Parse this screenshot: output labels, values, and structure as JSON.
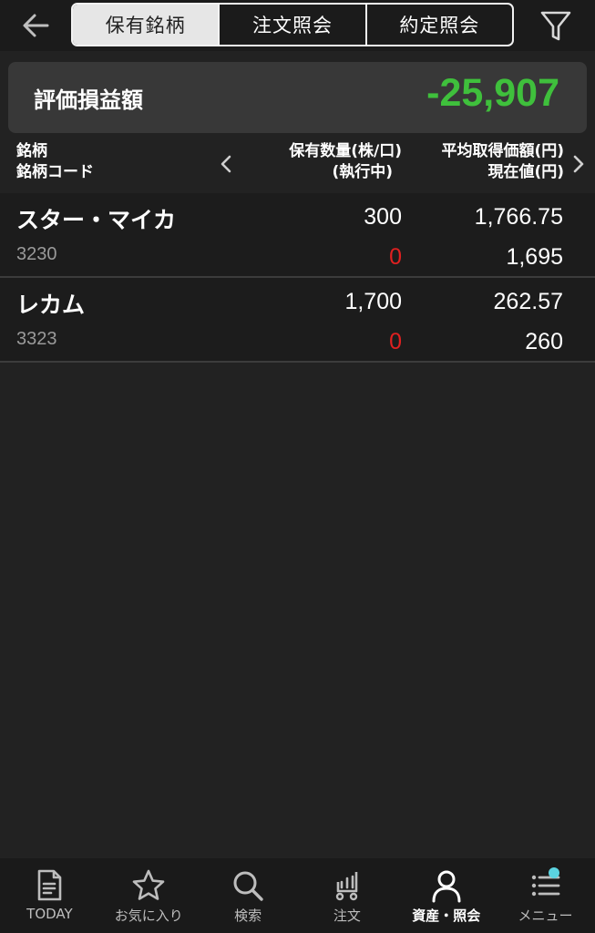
{
  "header": {
    "tabs": [
      {
        "label": "保有銘柄",
        "active": true
      },
      {
        "label": "注文照会",
        "active": false
      },
      {
        "label": "約定照会",
        "active": false
      }
    ],
    "icons": {
      "back": "arrow-left-icon",
      "filter": "filter-icon"
    }
  },
  "summary": {
    "label": "評価損益額",
    "value": "-25,907",
    "value_color": "#3fc03c"
  },
  "columns": {
    "name_line1": "銘柄",
    "name_line2": "銘柄コード",
    "qty_line1": "保有数量(株/口)",
    "qty_line2": "(執行中)",
    "avg_line1": "平均取得価額(円)",
    "avg_line2": "現在値(円)"
  },
  "holdings": [
    {
      "name": "スター・マイカ",
      "code": "3230",
      "quantity": "300",
      "pending": "0",
      "avg_price": "1,766.75",
      "current_price": "1,695"
    },
    {
      "name": "レカム",
      "code": "3323",
      "quantity": "1,700",
      "pending": "0",
      "avg_price": "262.57",
      "current_price": "260"
    }
  ],
  "nav": [
    {
      "label": "TODAY",
      "icon": "document-icon"
    },
    {
      "label": "お気に入り",
      "icon": "star-icon"
    },
    {
      "label": "検索",
      "icon": "search-icon"
    },
    {
      "label": "注文",
      "icon": "cart-icon"
    },
    {
      "label": "資産・照会",
      "icon": "person-icon",
      "active": true
    },
    {
      "label": "メニュー",
      "icon": "menu-icon",
      "badge": true
    }
  ],
  "colors": {
    "background": "#222222",
    "gain_loss": "#3fc03c",
    "pending": "#e02020",
    "badge": "#5bd3e0"
  }
}
